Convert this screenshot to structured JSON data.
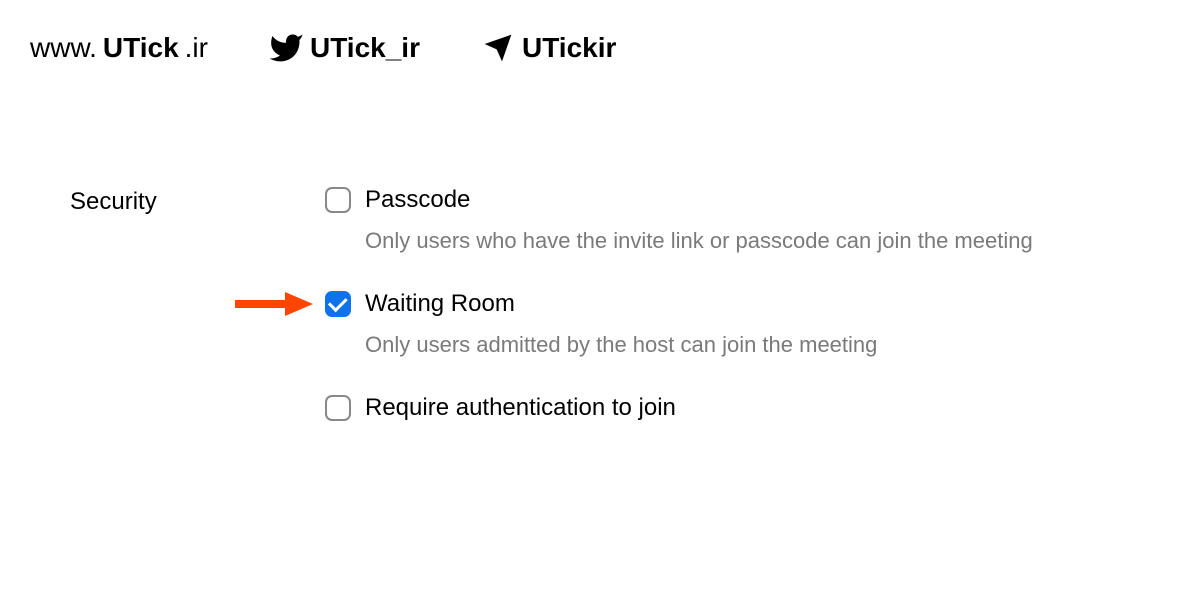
{
  "header": {
    "website": {
      "prefix": "www.",
      "bold": "UTick",
      "suffix": ".ir"
    },
    "twitter": {
      "bold": "UTick_ir",
      "suffix": ""
    },
    "telegram": {
      "bold": "UTickir",
      "suffix": ""
    }
  },
  "security": {
    "label": "Security",
    "options": [
      {
        "label": "Passcode",
        "desc": "Only users who have the invite link or passcode can join the meeting",
        "checked": false,
        "arrow": false
      },
      {
        "label": "Waiting Room",
        "desc": "Only users admitted by the host can join the meeting",
        "checked": true,
        "arrow": true
      },
      {
        "label": "Require authentication to join",
        "desc": "",
        "checked": false,
        "arrow": false
      }
    ]
  },
  "colors": {
    "accent": "#0e72ed",
    "arrow": "#ff4500",
    "muted": "#7a7a7a"
  }
}
